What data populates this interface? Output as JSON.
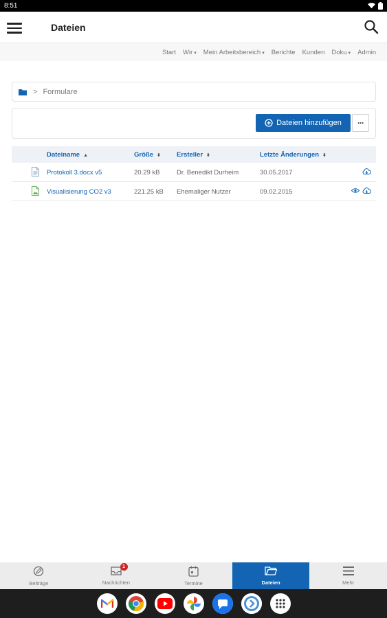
{
  "status_bar": {
    "time": "8:51"
  },
  "app_bar": {
    "title": "Dateien"
  },
  "top_nav": {
    "items": [
      {
        "label": "Start",
        "has_caret": false
      },
      {
        "label": "Wir",
        "has_caret": true
      },
      {
        "label": "Mein Arbeitsbereich",
        "has_caret": true
      },
      {
        "label": "Berichte",
        "has_caret": false
      },
      {
        "label": "Kunden",
        "has_caret": false
      },
      {
        "label": "Doku",
        "has_caret": true
      },
      {
        "label": "Admin",
        "has_caret": false
      }
    ]
  },
  "breadcrumb": {
    "folder": "Formulare"
  },
  "actions": {
    "add_files": "Dateien hinzufügen",
    "more": "···"
  },
  "table": {
    "headers": {
      "name": "Dateiname",
      "size": "Größe",
      "creator": "Ersteller",
      "modified": "Letzte Änderungen"
    },
    "rows": [
      {
        "name": "Protokoll 3.docx v5",
        "size": "20.29 kB",
        "creator": "Dr. Benedikt Durheim",
        "modified": "30.05.2017",
        "type": "document",
        "has_preview": false
      },
      {
        "name": "Visualisierung CO2 v3",
        "size": "221.25 kB",
        "creator": "Ehemaliger Nutzer",
        "modified": "09.02.2015",
        "type": "image",
        "has_preview": true
      }
    ]
  },
  "bottom_nav": {
    "items": [
      {
        "label": "Beiträge",
        "icon": "posts-icon"
      },
      {
        "label": "Nachrichten",
        "icon": "inbox-icon",
        "badge": "1"
      },
      {
        "label": "Termine",
        "icon": "calendar-icon"
      },
      {
        "label": "Dateien",
        "icon": "folder-icon",
        "active": true
      },
      {
        "label": "Mehr",
        "icon": "menu-icon"
      }
    ]
  },
  "dock": {
    "apps": [
      "gmail-icon",
      "chrome-icon",
      "youtube-icon",
      "photos-icon",
      "messages-icon",
      "app-icon",
      "apps-grid-icon"
    ]
  },
  "colors": {
    "accent": "#1464b4",
    "badge": "#c62828",
    "dock_bg": "#1e1e1e"
  }
}
